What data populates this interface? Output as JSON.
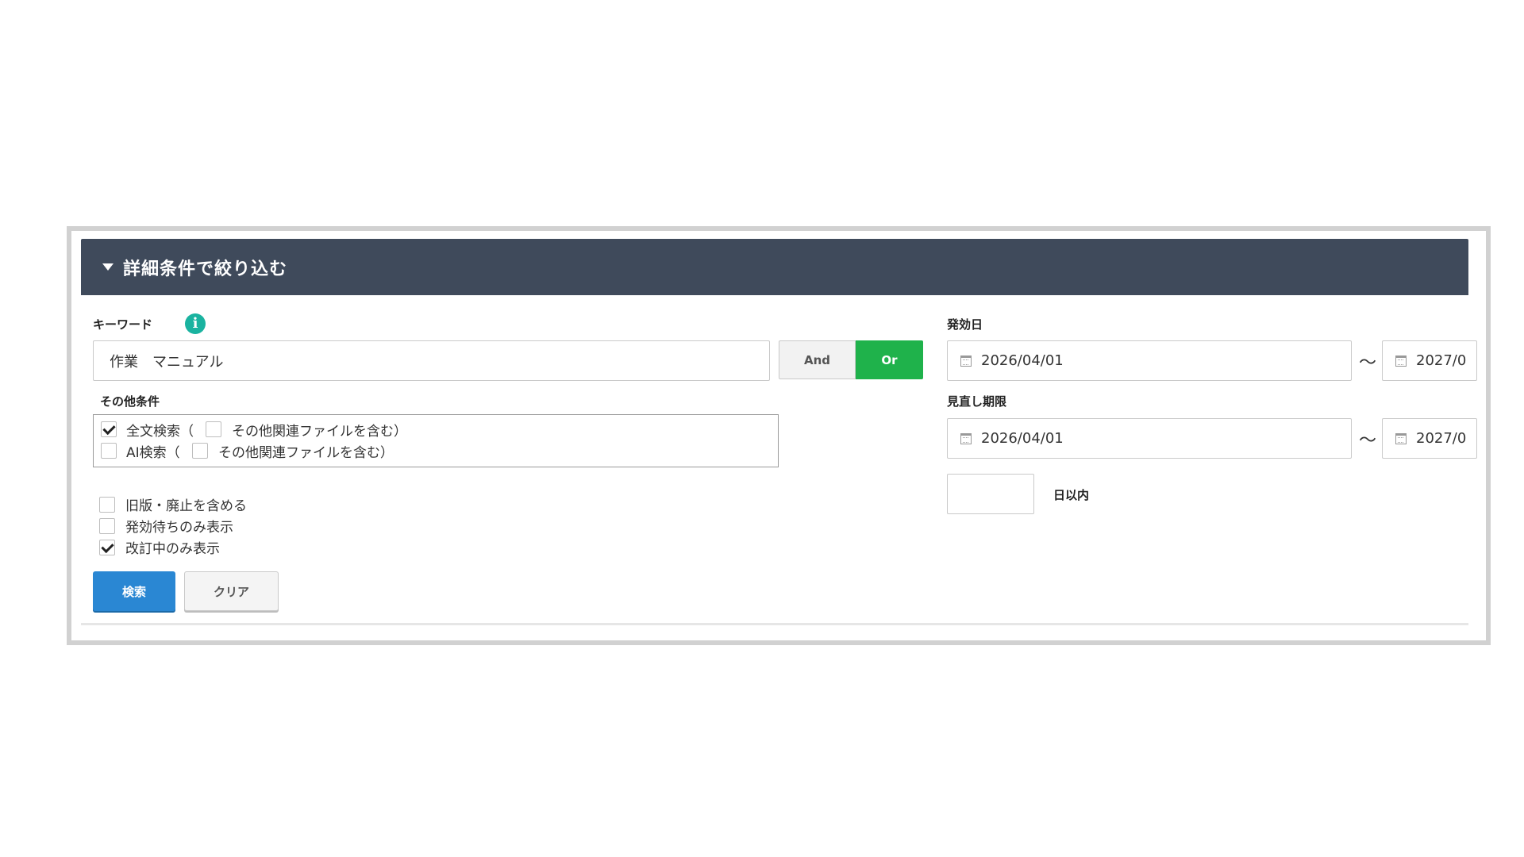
{
  "panel": {
    "title": "詳細条件で絞り込む"
  },
  "keyword": {
    "label": "キーワード",
    "value": "作業　マニュアル",
    "toggle": {
      "and_label": "And",
      "or_label": "Or",
      "selected": "Or"
    }
  },
  "other_conditions": {
    "label": "その他条件",
    "options": [
      {
        "checked": true,
        "label": "全文検索（",
        "sub_checked": false,
        "sub_label": "その他関連ファイルを含む）"
      },
      {
        "checked": false,
        "label": "AI検索（",
        "sub_checked": false,
        "sub_label": "その他関連ファイルを含む）"
      }
    ]
  },
  "filters": [
    {
      "checked": false,
      "label": "旧版・廃止を含める"
    },
    {
      "checked": false,
      "label": "発効待ちのみ表示"
    },
    {
      "checked": true,
      "label": "改訂中のみ表示"
    }
  ],
  "buttons": {
    "search": "検索",
    "clear": "クリア"
  },
  "effective_date": {
    "label": "発効日",
    "from": "2026/04/01",
    "separator": "～",
    "to": "2027/0"
  },
  "review_deadline": {
    "label": "見直し期限",
    "from": "2026/04/01",
    "separator": "～",
    "to": "2027/0",
    "days_value": "",
    "days_suffix": "日以内"
  }
}
